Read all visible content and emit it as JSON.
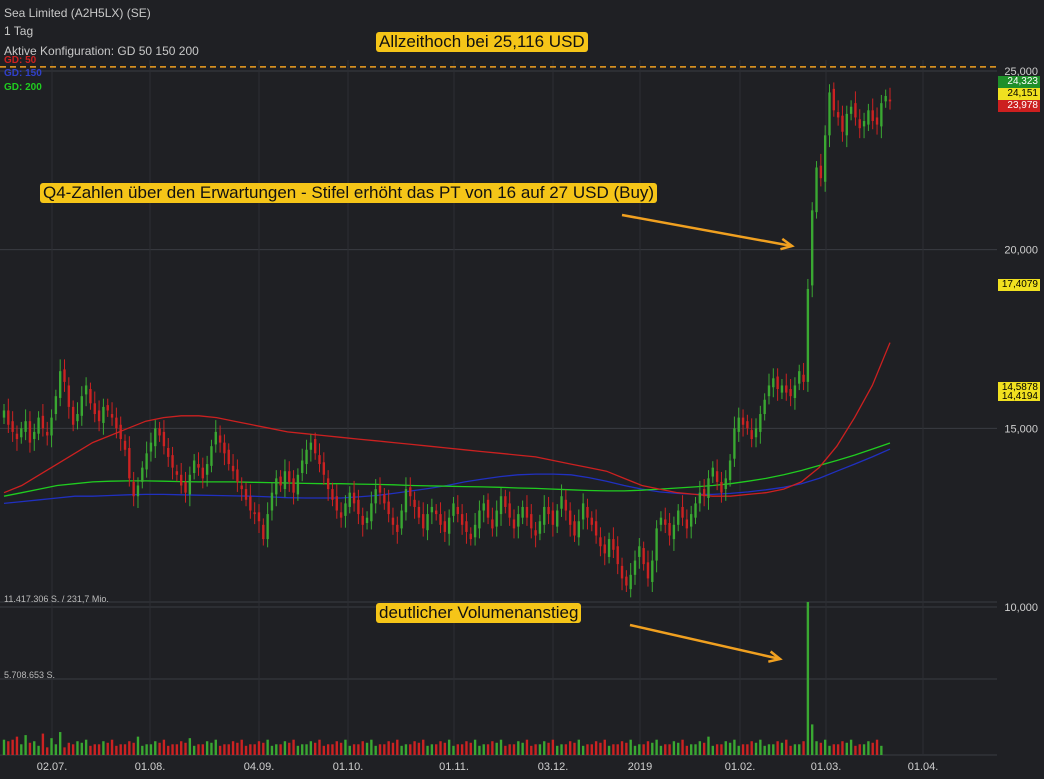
{
  "header": {
    "instrument": "Sea Limited (A2H5LX) (SE)",
    "period": "1 Tag",
    "config": "Aktive Konfiguration: GD 50 150 200"
  },
  "legend": [
    {
      "label": "GD: 50",
      "color": "#cc2020"
    },
    {
      "label": "GD: 150",
      "color": "#2030c0"
    },
    {
      "label": "GD: 200",
      "color": "#20cc20"
    }
  ],
  "annotations": {
    "ath": "Allzeithoch bei 25,116 USD",
    "q4": "Q4-Zahlen über den Erwartungen - Stifel erhöht das PT von 16 auf 27 USD (Buy)",
    "volume": "deutlicher Volumenanstieg"
  },
  "volume_labels": {
    "top": "11.417.306 S. / 231,7 Mio.",
    "mid": "5.708.653 S."
  },
  "price_tags": {
    "high": "24,323",
    "last": "24,151",
    "low": "23,978",
    "ma50": "17,4079",
    "ma150": "14,5878",
    "ma200": "14,4194"
  },
  "colors": {
    "up": "#3aa832",
    "down": "#cc2222",
    "ma50": "#cc2020",
    "ma150": "#2030c0",
    "ma200": "#20cc20",
    "ath_line": "#f0a020",
    "callout": "#f5c518"
  },
  "chart_data": {
    "type": "candlestick",
    "y_ticks": [
      "25,000",
      "20,000",
      "15,000",
      "10,000"
    ],
    "ylim": [
      10,
      25.5
    ],
    "x_ticks": [
      "02.07.",
      "01.08.",
      "04.09.",
      "01.10.",
      "01.11.",
      "03.12.",
      "2019",
      "01.02.",
      "01.03.",
      "01.04."
    ],
    "ath_level": 25.116,
    "close": [
      15.5,
      15.1,
      14.9,
      14.7,
      15.0,
      15.2,
      14.6,
      14.9,
      15.3,
      15.0,
      14.8,
      15.3,
      15.9,
      16.6,
      16.3,
      15.6,
      15.1,
      15.4,
      15.9,
      16.2,
      15.7,
      15.4,
      15.2,
      15.6,
      15.5,
      15.3,
      15.0,
      14.7,
      14.4,
      13.6,
      13.1,
      13.4,
      13.9,
      14.3,
      14.6,
      15.0,
      14.8,
      14.5,
      14.2,
      13.9,
      13.7,
      13.4,
      13.2,
      13.7,
      14.1,
      13.9,
      13.6,
      14.0,
      14.5,
      14.9,
      14.6,
      14.3,
      14.0,
      13.8,
      13.5,
      13.3,
      13.0,
      12.7,
      12.6,
      12.4,
      11.9,
      12.6,
      13.2,
      13.6,
      13.4,
      13.8,
      13.5,
      13.2,
      13.7,
      14.1,
      14.4,
      14.6,
      14.3,
      14.0,
      13.7,
      13.3,
      13.0,
      12.7,
      12.5,
      12.9,
      13.2,
      12.9,
      12.6,
      12.3,
      12.5,
      12.9,
      13.3,
      13.2,
      12.9,
      12.6,
      12.3,
      12.1,
      12.7,
      13.3,
      13.1,
      12.8,
      12.5,
      12.2,
      12.6,
      12.8,
      12.6,
      12.3,
      12.1,
      12.5,
      12.9,
      12.6,
      12.3,
      12.1,
      11.9,
      12.3,
      12.7,
      12.9,
      12.5,
      12.2,
      12.7,
      13.1,
      12.8,
      12.5,
      12.2,
      12.6,
      12.8,
      12.5,
      12.2,
      12.0,
      12.4,
      12.8,
      12.6,
      12.3,
      12.7,
      13.1,
      12.7,
      12.3,
      12.0,
      12.4,
      12.9,
      12.5,
      12.3,
      12.0,
      11.7,
      11.5,
      11.9,
      11.6,
      11.2,
      10.8,
      10.6,
      10.9,
      11.3,
      11.7,
      11.2,
      10.8,
      11.3,
      12.2,
      12.5,
      12.3,
      12.0,
      12.3,
      12.7,
      12.5,
      12.2,
      12.6,
      12.9,
      13.2,
      13.1,
      13.6,
      13.9,
      13.5,
      13.2,
      13.6,
      14.1,
      15.0,
      15.3,
      15.1,
      15.0,
      14.7,
      15.0,
      15.4,
      15.8,
      16.2,
      16.4,
      16.1,
      16.2,
      16.0,
      15.9,
      16.2,
      16.6,
      16.3,
      18.9,
      21.1,
      22.3,
      22.0,
      23.2,
      24.4,
      23.9,
      23.7,
      23.3,
      23.8,
      24.0,
      23.7,
      23.4,
      23.6,
      23.9,
      23.6,
      23.5,
      24.1,
      24.3,
      24.15
    ],
    "volume_ratio": [
      0.1,
      0.09,
      0.1,
      0.12,
      0.07,
      0.13,
      0.08,
      0.09,
      0.06,
      0.14,
      0.05,
      0.11,
      0.07,
      0.15,
      0.05,
      0.08,
      0.07,
      0.09,
      0.08,
      0.1,
      0.06,
      0.07,
      0.07,
      0.09,
      0.08,
      0.1,
      0.06,
      0.07,
      0.07,
      0.09,
      0.08,
      0.12,
      0.06,
      0.07,
      0.07,
      0.09,
      0.08,
      0.1,
      0.06,
      0.07,
      0.07,
      0.09,
      0.08,
      0.11,
      0.06,
      0.07,
      0.07,
      0.09,
      0.08,
      0.1,
      0.06,
      0.07,
      0.07,
      0.09,
      0.08,
      0.1,
      0.06,
      0.07,
      0.07,
      0.09,
      0.08,
      0.1,
      0.06,
      0.07,
      0.07,
      0.09,
      0.08,
      0.1,
      0.06,
      0.07,
      0.07,
      0.09,
      0.08,
      0.1,
      0.06,
      0.07,
      0.07,
      0.09,
      0.08,
      0.1,
      0.06,
      0.07,
      0.07,
      0.09,
      0.08,
      0.1,
      0.06,
      0.07,
      0.07,
      0.09,
      0.08,
      0.1,
      0.06,
      0.07,
      0.07,
      0.09,
      0.08,
      0.1,
      0.06,
      0.07,
      0.07,
      0.09,
      0.08,
      0.1,
      0.06,
      0.07,
      0.07,
      0.09,
      0.08,
      0.1,
      0.06,
      0.07,
      0.07,
      0.09,
      0.08,
      0.1,
      0.06,
      0.07,
      0.07,
      0.09,
      0.08,
      0.1,
      0.06,
      0.07,
      0.07,
      0.09,
      0.08,
      0.1,
      0.06,
      0.07,
      0.07,
      0.09,
      0.08,
      0.1,
      0.06,
      0.07,
      0.07,
      0.09,
      0.08,
      0.1,
      0.06,
      0.07,
      0.07,
      0.09,
      0.08,
      0.1,
      0.06,
      0.07,
      0.07,
      0.09,
      0.08,
      0.1,
      0.06,
      0.07,
      0.07,
      0.09,
      0.08,
      0.1,
      0.06,
      0.07,
      0.07,
      0.09,
      0.08,
      0.12,
      0.06,
      0.07,
      0.07,
      0.09,
      0.08,
      0.1,
      0.06,
      0.07,
      0.07,
      0.09,
      0.08,
      0.1,
      0.06,
      0.07,
      0.07,
      0.09,
      0.08,
      0.1,
      0.06,
      0.07,
      0.07,
      0.09,
      1.0,
      0.2,
      0.09,
      0.08,
      0.1,
      0.06,
      0.07,
      0.07,
      0.09,
      0.08,
      0.1,
      0.06,
      0.07,
      0.07,
      0.09,
      0.08,
      0.1,
      0.06
    ],
    "ma50": [
      13.2,
      13.4,
      13.7,
      14.0,
      14.3,
      14.6,
      14.8,
      15.0,
      15.2,
      15.3,
      15.35,
      15.35,
      15.3,
      15.2,
      15.1,
      15.0,
      14.9,
      14.85,
      14.8,
      14.75,
      14.7,
      14.65,
      14.6,
      14.55,
      14.5,
      14.45,
      14.4,
      14.35,
      14.3,
      14.25,
      14.2,
      14.1,
      14.0,
      13.9,
      13.8,
      13.6,
      13.4,
      13.3,
      13.2,
      13.15,
      13.1,
      13.1,
      13.15,
      13.2,
      13.3,
      13.5,
      13.9,
      14.5,
      15.3,
      16.2,
      17.4
    ],
    "ma150": [
      12.9,
      12.95,
      13.0,
      13.05,
      13.1,
      13.1,
      13.12,
      13.14,
      13.15,
      13.15,
      13.14,
      13.13,
      13.12,
      13.11,
      13.1,
      13.08,
      13.06,
      13.05,
      13.05,
      13.05,
      13.08,
      13.12,
      13.18,
      13.25,
      13.32,
      13.4,
      13.5,
      13.58,
      13.65,
      13.7,
      13.72,
      13.72,
      13.7,
      13.62,
      13.52,
      13.4,
      13.3,
      13.22,
      13.18,
      13.15,
      13.15,
      13.18,
      13.22,
      13.28,
      13.35,
      13.45,
      13.6,
      13.8,
      14.0,
      14.2,
      14.42
    ],
    "ma200": [
      13.1,
      13.2,
      13.3,
      13.4,
      13.45,
      13.5,
      13.52,
      13.53,
      13.53,
      13.52,
      13.51,
      13.5,
      13.5,
      13.5,
      13.49,
      13.48,
      13.47,
      13.46,
      13.45,
      13.45,
      13.44,
      13.43,
      13.42,
      13.4,
      13.39,
      13.38,
      13.37,
      13.36,
      13.35,
      13.33,
      13.32,
      13.3,
      13.28,
      13.26,
      13.25,
      13.25,
      13.27,
      13.3,
      13.33,
      13.36,
      13.4,
      13.45,
      13.52,
      13.6,
      13.7,
      13.82,
      13.96,
      14.1,
      14.25,
      14.42,
      14.59
    ]
  }
}
